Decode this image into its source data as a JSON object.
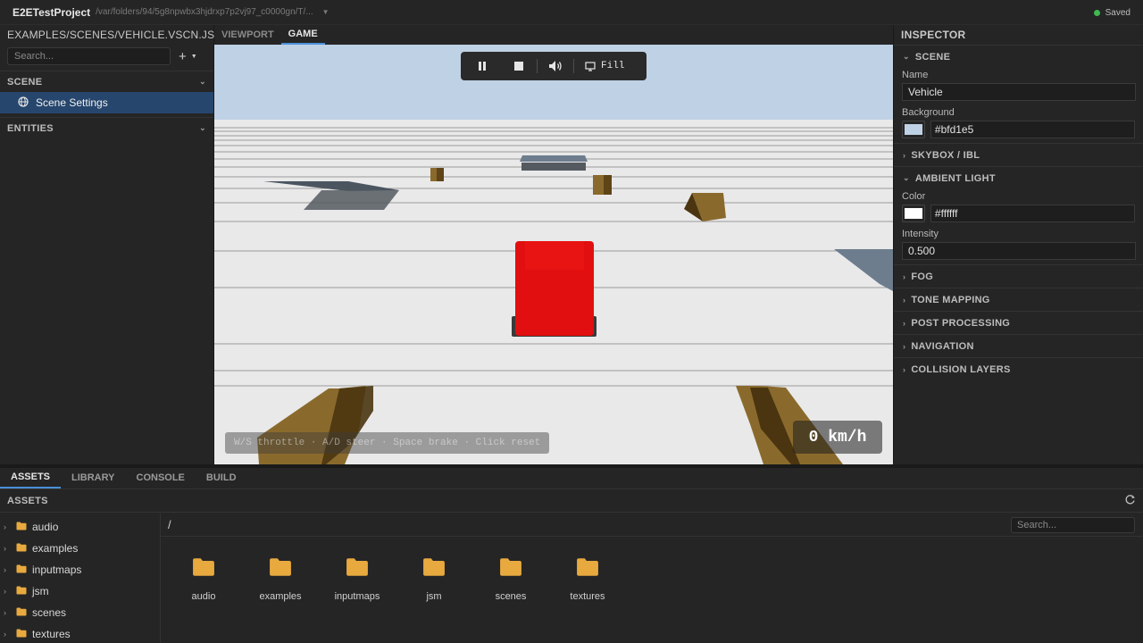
{
  "titlebar": {
    "app_title": "E2ETestProject",
    "project_path": "/var/folders/94/5g8npwbx3hjdrxp7p2vj97_c0000gn/T/...",
    "save_status": "Saved",
    "save_status_color": "#3fb950"
  },
  "left_panel": {
    "scene_file": "EXAMPLES/SCENES/VEHICLE.VSCN.JSON",
    "search_placeholder": "Search...",
    "scene_section": "SCENE",
    "scene_settings_label": "Scene Settings",
    "entities_section": "ENTITIES"
  },
  "view_tabs": [
    "VIEWPORT",
    "GAME"
  ],
  "active_view_tab": "GAME",
  "game": {
    "fill_label": "Fill",
    "controls_hint": "W/S throttle · A/D steer · Space brake · Click reset",
    "speed": "0 km/h",
    "sky_color": "#bfd1e5"
  },
  "inspector": {
    "title": "INSPECTOR",
    "scene_section": "SCENE",
    "name_label": "Name",
    "name_value": "Vehicle",
    "background_label": "Background",
    "background_value": "#bfd1e5",
    "skybox_section": "SKYBOX / IBL",
    "ambient_section": "AMBIENT LIGHT",
    "color_label": "Color",
    "color_value": "#ffffff",
    "intensity_label": "Intensity",
    "intensity_value": "0.500",
    "collapsed_sections": [
      "FOG",
      "TONE MAPPING",
      "POST PROCESSING",
      "NAVIGATION",
      "COLLISION LAYERS"
    ]
  },
  "bottom": {
    "tabs": [
      "ASSETS",
      "LIBRARY",
      "CONSOLE",
      "BUILD"
    ],
    "active_tab": "ASSETS",
    "assets_header": "ASSETS",
    "current_path": "/",
    "search_placeholder": "Search...",
    "tree": [
      "audio",
      "examples",
      "inputmaps",
      "jsm",
      "scenes",
      "textures"
    ],
    "grid": [
      "audio",
      "examples",
      "inputmaps",
      "jsm",
      "scenes",
      "textures"
    ],
    "folder_color": "#e8a93e"
  }
}
